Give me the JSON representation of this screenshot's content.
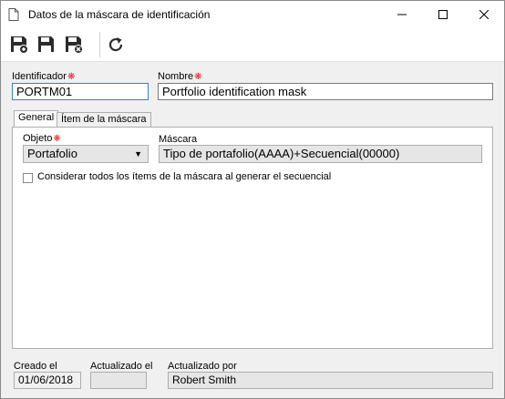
{
  "window": {
    "title": "Datos de la máscara de identificación"
  },
  "toolbar": {
    "buttons": [
      "save-new",
      "save",
      "save-close",
      "refresh"
    ]
  },
  "form": {
    "identifier_label": "Identificador",
    "identifier_value": "PORTM01",
    "name_label": "Nombre",
    "name_value": "Portfolio identification mask"
  },
  "tabs": [
    {
      "label": "General",
      "active": true
    },
    {
      "label": "Ítem de la máscara",
      "active": false
    }
  ],
  "general": {
    "object_label": "Objeto",
    "object_value": "Portafolio",
    "mask_label": "Máscara",
    "mask_value": "Tipo de portafolio(AAAA)+Secuencial(00000)",
    "checkbox_label": "Considerar todos los ítems de la máscara al generar el secuencial",
    "checkbox_checked": false
  },
  "footer": {
    "created_label": "Creado el",
    "created_value": "01/06/2018",
    "updated_label": "Actualizado el",
    "updated_value": "",
    "updated_by_label": "Actualizado por",
    "updated_by_value": "Robert Smith"
  },
  "colors": {
    "required": "#e02020",
    "focus_border": "#3c7fc1"
  }
}
